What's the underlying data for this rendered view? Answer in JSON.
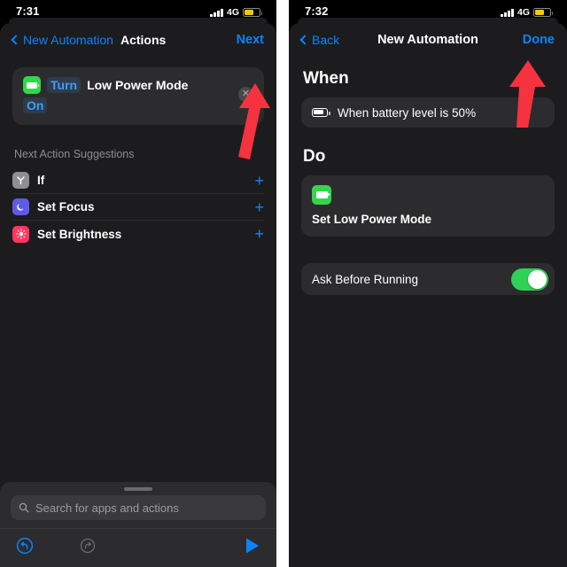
{
  "left": {
    "status": {
      "time": "7:31",
      "network": "4G",
      "battery_color": "#f5c518"
    },
    "nav": {
      "back_label": "New Automation",
      "title": "Actions",
      "action_label": "Next"
    },
    "action_card": {
      "icon": "low-power-mode-icon",
      "token_turn": "Turn",
      "target": "Low Power Mode",
      "token_state": "On",
      "close_label": "✕"
    },
    "suggestions_header": "Next Action Suggestions",
    "suggestions": [
      {
        "label": "If",
        "icon": "if-branch-icon",
        "add": "+"
      },
      {
        "label": "Set Focus",
        "icon": "focus-moon-icon",
        "add": "+"
      },
      {
        "label": "Set Brightness",
        "icon": "brightness-sun-icon",
        "add": "+"
      }
    ],
    "search": {
      "placeholder": "Search for apps and actions",
      "icon": "search-icon"
    },
    "toolbar": {
      "undo": "undo-icon",
      "redo": "redo-icon",
      "play": "play-icon"
    }
  },
  "right": {
    "status": {
      "time": "7:32",
      "network": "4G",
      "battery_color": "#f5c518"
    },
    "nav": {
      "back_label": "Back",
      "title": "New Automation",
      "action_label": "Done"
    },
    "when": {
      "heading": "When",
      "trigger_label": "When battery level is 50%",
      "trigger_icon": "battery-icon"
    },
    "do": {
      "heading": "Do",
      "action_icon": "low-power-mode-icon",
      "action_label": "Set Low Power Mode"
    },
    "ask": {
      "label": "Ask Before Running",
      "state": "on"
    }
  },
  "annotations": {
    "arrow_color": "#f5333f",
    "left_arrow": "points-to-next-button",
    "right_arrow": "points-to-done-button"
  }
}
